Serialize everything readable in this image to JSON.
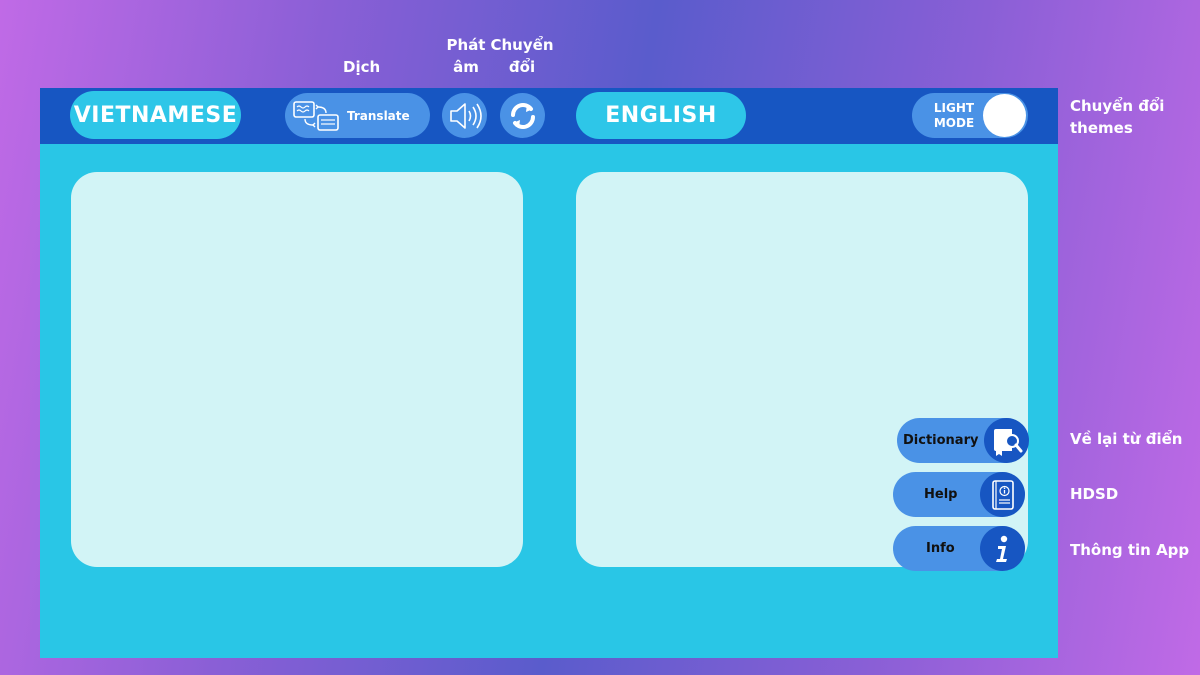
{
  "annotations": {
    "translate": "Dịch",
    "pronounce_line1": "Phát",
    "pronounce_line2": "âm",
    "swap_line1": "Chuyển",
    "swap_line2": "đổi",
    "themes_line1": "Chuyển đổi",
    "themes_line2": "themes",
    "dictionary": "Về lại từ điển",
    "help": "HDSD",
    "info": "Thông tin App"
  },
  "topbar": {
    "source_language": "VIETNAMESE",
    "translate_label": "Translate",
    "target_language": "ENGLISH",
    "theme_line1": "LIGHT",
    "theme_line2": "MODE"
  },
  "side_buttons": {
    "dictionary": "Dictionary",
    "help": "Help",
    "info": "Info"
  },
  "icons": {
    "translate": "translate-icon",
    "speaker": "speaker-icon",
    "swap": "swap-icon",
    "dictionary": "book-search-icon",
    "help": "manual-book-icon",
    "info": "info-icon"
  },
  "colors": {
    "topbar": "#1756c2",
    "app_background": "#29c6e6",
    "button": "#4a92e6",
    "panel": "#d2f4f6"
  }
}
